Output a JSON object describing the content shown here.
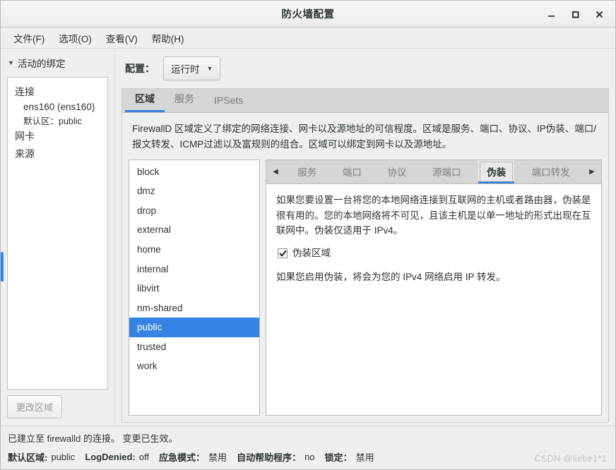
{
  "window": {
    "title": "防火墙配置",
    "controls": [
      {
        "name": "minimize",
        "glyph": "minimize-icon"
      },
      {
        "name": "maximize",
        "glyph": "maximize-icon"
      },
      {
        "name": "close",
        "glyph": "close-icon"
      }
    ]
  },
  "menubar": {
    "items": [
      {
        "label": "文件(F)"
      },
      {
        "label": "选项(O)"
      },
      {
        "label": "查看(V)"
      },
      {
        "label": "帮助(H)"
      }
    ]
  },
  "sidebar": {
    "header": "活动的绑定",
    "groups": [
      {
        "title": "连接",
        "items": [
          {
            "text": "ens160 (ens160)"
          },
          {
            "text": "默认区：public"
          }
        ]
      },
      {
        "title": "网卡",
        "items": []
      },
      {
        "title": "来源",
        "items": []
      }
    ],
    "change_zone_button": "更改区域"
  },
  "toolbar": {
    "config_label": "配置：",
    "config_value": "运行时"
  },
  "main": {
    "tabs": [
      {
        "label": "区域",
        "active": true
      },
      {
        "label": "服务",
        "active": false
      },
      {
        "label": "IPSets",
        "active": false
      }
    ],
    "description": "FirewallD 区域定义了绑定的网络连接、网卡以及源地址的可信程度。区域是服务、端口、协议、IP伪装、端口/报文转发、ICMP过滤以及富规则的组合。区域可以绑定到网卡以及源地址。",
    "zones": [
      {
        "name": "block",
        "selected": false
      },
      {
        "name": "dmz",
        "selected": false
      },
      {
        "name": "drop",
        "selected": false
      },
      {
        "name": "external",
        "selected": false
      },
      {
        "name": "home",
        "selected": false
      },
      {
        "name": "internal",
        "selected": false
      },
      {
        "name": "libvirt",
        "selected": false
      },
      {
        "name": "nm-shared",
        "selected": false
      },
      {
        "name": "public",
        "selected": true
      },
      {
        "name": "trusted",
        "selected": false
      },
      {
        "name": "work",
        "selected": false
      }
    ],
    "subtabs": {
      "prev_arrow": "◀",
      "next_arrow": "▶",
      "items": [
        {
          "label": "服务",
          "active": false
        },
        {
          "label": "端口",
          "active": false
        },
        {
          "label": "协议",
          "active": false
        },
        {
          "label": "源端口",
          "active": false
        },
        {
          "label": "伪装",
          "active": true
        },
        {
          "label": "端口转发",
          "active": false
        }
      ]
    },
    "masquerade": {
      "paragraph1": "如果您要设置一台将您的本地网络连接到互联网的主机或者路由器，伪装是很有用的。您的本地网络将不可见，且该主机是以单一地址的形式出现在互联网中。伪装仅适用于 IPv4。",
      "checkbox_label": "伪装区域",
      "checkbox_checked": true,
      "paragraph2": "如果您启用伪装，将会为您的 IPv4 网络启用 IP 转发。"
    }
  },
  "statusbar": {
    "message": "已建立至 firewalld 的连接。 变更已生效。",
    "fields": [
      {
        "key": "默认区域:",
        "value": "public"
      },
      {
        "key": "LogDenied:",
        "value": "off"
      },
      {
        "key": "应急模式：",
        "value": "禁用"
      },
      {
        "key": "自动帮助程序：",
        "value": "no"
      },
      {
        "key": "锁定：",
        "value": "禁用"
      }
    ],
    "watermark": "CSDN @liebe1*1"
  },
  "colors": {
    "accent": "#3584e4",
    "window_bg": "#efefef",
    "tabbar_bg": "#d6d6d6"
  }
}
